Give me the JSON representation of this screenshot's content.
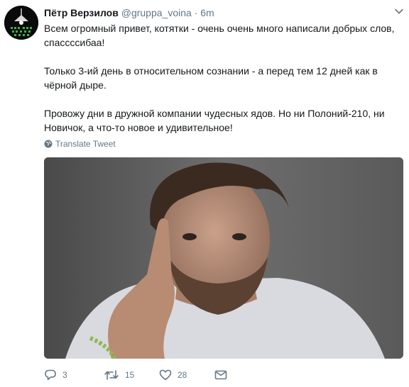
{
  "tweet": {
    "display_name": "Пётр Верзилов",
    "handle": "@gruppa_voina",
    "separator": "·",
    "time": "6m",
    "paragraphs": [
      "Всем огромный привет, котятки - очень очень много написали добрых слов,\nспассссибаа!",
      "Только 3-ий день в относительном сознании - а перед тем 12 дней как в\nчёрной дыре.",
      "Провожу дни в дружной компании чудесных ядов. Но ни Полоний-210, ни\nНовичок, а что-то новое и удивительное!"
    ],
    "translate_label": "Translate Tweet"
  },
  "actions": {
    "reply_count": "3",
    "retweet_count": "15",
    "like_count": "28"
  },
  "icons": {
    "avatar": "avatar-lamp-icon",
    "caret": "chevron-down-icon",
    "translate": "globe-icon",
    "reply": "reply-icon",
    "retweet": "retweet-icon",
    "like": "heart-icon",
    "message": "envelope-icon"
  },
  "colors": {
    "text": "#14171a",
    "secondary": "#657786",
    "avatar_bg": "#0a0a0a",
    "avatar_accent": "#3fae49"
  }
}
